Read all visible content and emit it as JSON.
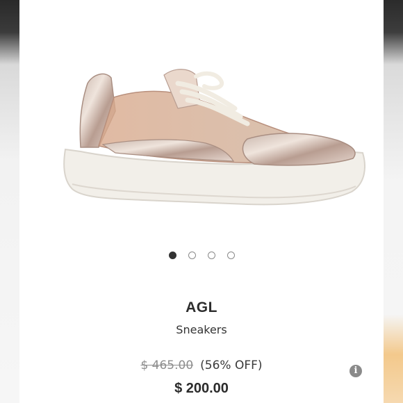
{
  "carousel": {
    "slide_count": 4,
    "active_index": 0
  },
  "product": {
    "brand": "AGL",
    "category": "Sneakers",
    "original_price": "$ 465.00",
    "discount": "(56% OFF)",
    "final_price": "$ 200.00"
  },
  "icons": {
    "info": "info-icon"
  },
  "colors": {
    "text_dark": "#2d2d2d",
    "strike_gray": "#8d8d8d",
    "dot_active": "#333333"
  }
}
